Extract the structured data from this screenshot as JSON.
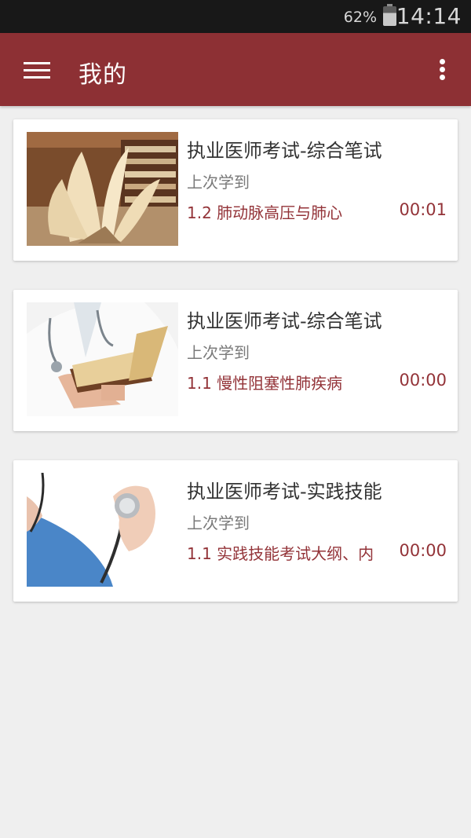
{
  "status_bar": {
    "battery": "62%",
    "time": "14:14"
  },
  "app_bar": {
    "title": "我的",
    "menu_icon": "hamburger-menu-icon",
    "overflow_icon": "more-vert-icon",
    "color": "#8d3034"
  },
  "courses": [
    {
      "title": "执业医师考试-综合笔试",
      "last_label": "上次学到",
      "lesson": "1.2 肺动脉高压与肺心",
      "time": "00:01",
      "thumbnail": "open-book-stack-image"
    },
    {
      "title": "执业医师考试-综合笔试",
      "last_label": "上次学到",
      "lesson": "1.1 慢性阻塞性肺疾病",
      "time": "00:00",
      "thumbnail": "doctor-holding-book-image"
    },
    {
      "title": "执业医师考试-实践技能",
      "last_label": "上次学到",
      "lesson": "1.1 实践技能考试大纲、内",
      "time": "00:00",
      "thumbnail": "doctor-stethoscope-image"
    }
  ],
  "accent_color": "#933338"
}
